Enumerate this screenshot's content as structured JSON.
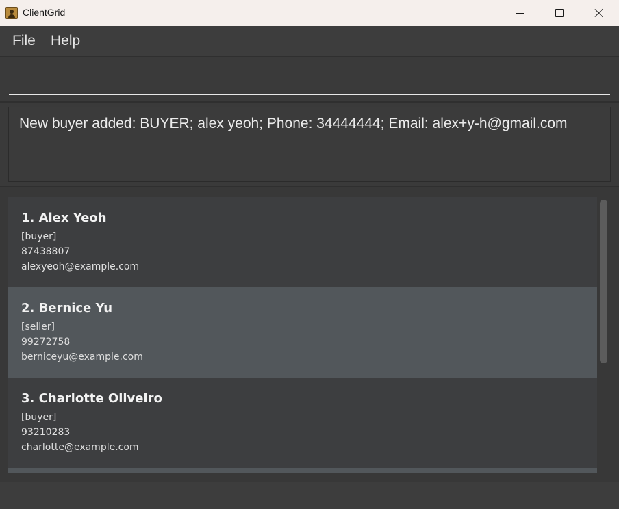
{
  "window": {
    "title": "ClientGrid",
    "icon": "contact-card-icon",
    "controls": [
      "minimize-icon",
      "maximize-icon",
      "close-icon"
    ]
  },
  "menu": {
    "file_label": "File",
    "help_label": "Help"
  },
  "command": {
    "value": "",
    "placeholder": ""
  },
  "result": {
    "message": "New buyer added: BUYER; alex yeoh; Phone: 34444444; Email: alex+y-h@gmail.com"
  },
  "clients": [
    {
      "name": "1. Alex Yeoh",
      "tag": "[buyer]",
      "phone": "87438807",
      "email": "alexyeoh@example.com",
      "selected": false
    },
    {
      "name": "2. Bernice Yu",
      "tag": "[seller]",
      "phone": "99272758",
      "email": "berniceyu@example.com",
      "selected": true
    },
    {
      "name": "3. Charlotte Oliveiro",
      "tag": "[buyer]",
      "phone": "93210283",
      "email": "charlotte@example.com",
      "selected": false
    }
  ],
  "colors": {
    "background": "#3a3a3a",
    "card": "#3d3e40",
    "card_selected": "#52575b",
    "titlebar": "#f5efec",
    "text": "#ebebeb"
  }
}
